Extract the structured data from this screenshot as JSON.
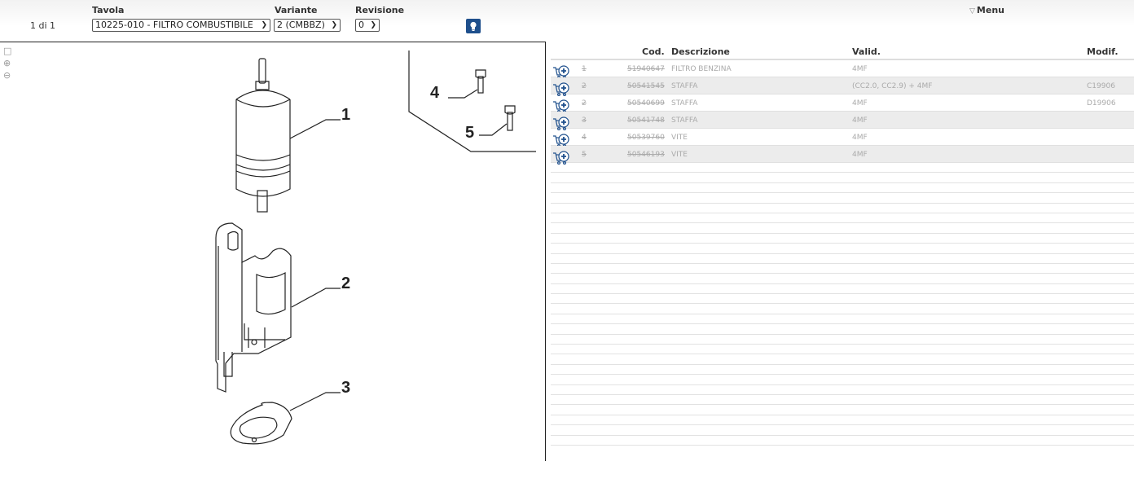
{
  "toolbar": {
    "tavola_label": "Tavola",
    "variante_label": "Variante",
    "revisione_label": "Revisione",
    "page_count": "1 di 1",
    "tavola_value": "10225-010 - FILTRO COMBUSTIBILE",
    "variante_value": "2 (CMBBZ)",
    "revisione_value": "0",
    "menu_label": "Menu"
  },
  "drawing": {
    "callouts": [
      "1",
      "2",
      "3",
      "4",
      "5"
    ],
    "tools": [
      "fit-page-icon",
      "zoom-in-icon",
      "zoom-out-icon"
    ]
  },
  "parts_table": {
    "headers": {
      "cod": "Cod.",
      "descrizione": "Descrizione",
      "valid": "Valid.",
      "modif": "Modif."
    },
    "rows": [
      {
        "pos": "1",
        "cod": "51940647",
        "descrizione": "FILTRO BENZINA",
        "valid": "4MF",
        "modif": ""
      },
      {
        "pos": "2",
        "cod": "50541545",
        "descrizione": "STAFFA",
        "valid": "(CC2.0, CC2.9) + 4MF",
        "modif": "C19906"
      },
      {
        "pos": "2",
        "cod": "50540699",
        "descrizione": "STAFFA",
        "valid": "4MF",
        "modif": "D19906"
      },
      {
        "pos": "3",
        "cod": "50541748",
        "descrizione": "STAFFA",
        "valid": "4MF",
        "modif": ""
      },
      {
        "pos": "4",
        "cod": "50539760",
        "descrizione": "VITE",
        "valid": "4MF",
        "modif": ""
      },
      {
        "pos": "5",
        "cod": "50546193",
        "descrizione": "VITE",
        "valid": "4MF",
        "modif": ""
      }
    ]
  },
  "colors": {
    "accent": "#1e4f8c",
    "row_alt": "#ececec"
  }
}
